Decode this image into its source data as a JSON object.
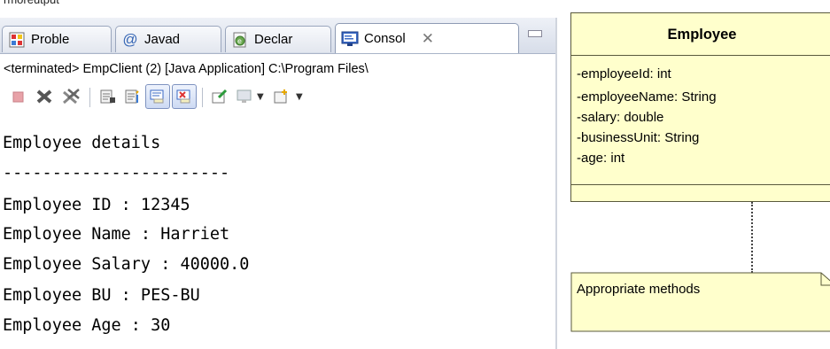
{
  "top_crop": {
    "text": "rmoreutput"
  },
  "tabs": [
    {
      "label": "Proble",
      "icon": "problems-icon"
    },
    {
      "label": "Javad",
      "icon": "javadoc-at-icon"
    },
    {
      "label": "Declar",
      "icon": "declaration-icon"
    },
    {
      "label": "Consol",
      "icon": "console-icon",
      "active": true,
      "close": "✕"
    }
  ],
  "console": {
    "status": "<terminated> EmpClient (2) [Java Application] C:\\Program Files\\",
    "toolbar": [
      "terminate-icon",
      "remove-launch-icon",
      "remove-all-terminated-icon",
      "scroll-lock-icon",
      "clear-console-icon",
      "show-on-stdout-icon",
      "show-on-stderr-icon",
      "pin-console-icon",
      "display-selected-console-icon",
      "open-console-icon"
    ],
    "lines": [
      "Employee details",
      "-----------------------",
      "Employee ID : 12345",
      "Employee Name : Harriet",
      "Employee Salary : 40000.0",
      "Employee BU : PES-BU",
      "Employee Age : 30"
    ]
  },
  "uml": {
    "class_name": "Employee",
    "attributes": [
      "-employeeId: int",
      "-employeeName: String",
      "-salary: double",
      "-businessUnit: String",
      "-age: int"
    ],
    "note": "Appropriate  methods",
    "colors": {
      "class_fill": "#ffffcc",
      "border": "#5a5a3c"
    }
  }
}
